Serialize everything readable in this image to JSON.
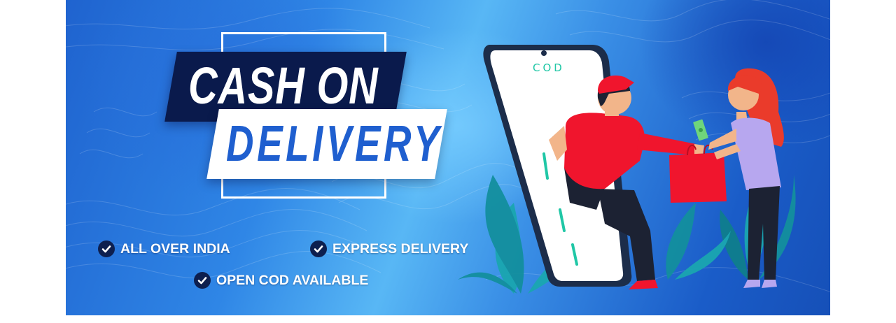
{
  "banner": {
    "title_line1": "CASH ON",
    "title_line2": "DELIVERY",
    "phone_label": "COD",
    "features": [
      {
        "label": "ALL OVER INDIA",
        "icon": "check-circle-icon"
      },
      {
        "label": "EXPRESS DELIVERY",
        "icon": "check-circle-icon"
      },
      {
        "label": "OPEN COD AVAILABLE",
        "icon": "check-circle-icon"
      }
    ],
    "colors": {
      "background_blue": "#2f86e6",
      "title_band": "#0a1a4c",
      "title_accent": "#1f5fcf",
      "check_circle": "#0d1f4f",
      "courier_shirt": "#f0152d",
      "customer_top": "#b7a7ef",
      "leaves": "#1aa6b0"
    }
  }
}
